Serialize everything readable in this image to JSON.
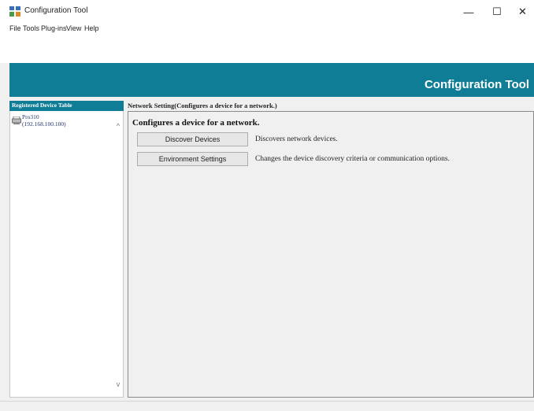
{
  "window": {
    "title": "Configuration Tool",
    "controls": {
      "minimize": "—",
      "maximize": "☐",
      "close": "✕"
    }
  },
  "menu": {
    "items": [
      "File",
      "Tools",
      "Plug-ins",
      "View",
      "Help"
    ]
  },
  "banner": {
    "title": "Configuration Tool"
  },
  "left_panel": {
    "header": "Registered Device Table",
    "devices": [
      {
        "name": "Pro310",
        "ip": "(192.168.100.100)"
      }
    ],
    "scroll_up": "^",
    "scroll_down": "v"
  },
  "main": {
    "header": "Network Setting(Configures a device for a network.)",
    "section_title": "Configures a device for a network.",
    "actions": [
      {
        "label": "Discover Devices",
        "description": "Discovers network devices."
      },
      {
        "label": "Environment Settings",
        "description": "Changes the device discovery criteria or communication options."
      }
    ]
  },
  "colors": {
    "accent": "#0f7d96",
    "background": "#f0f0f0"
  }
}
